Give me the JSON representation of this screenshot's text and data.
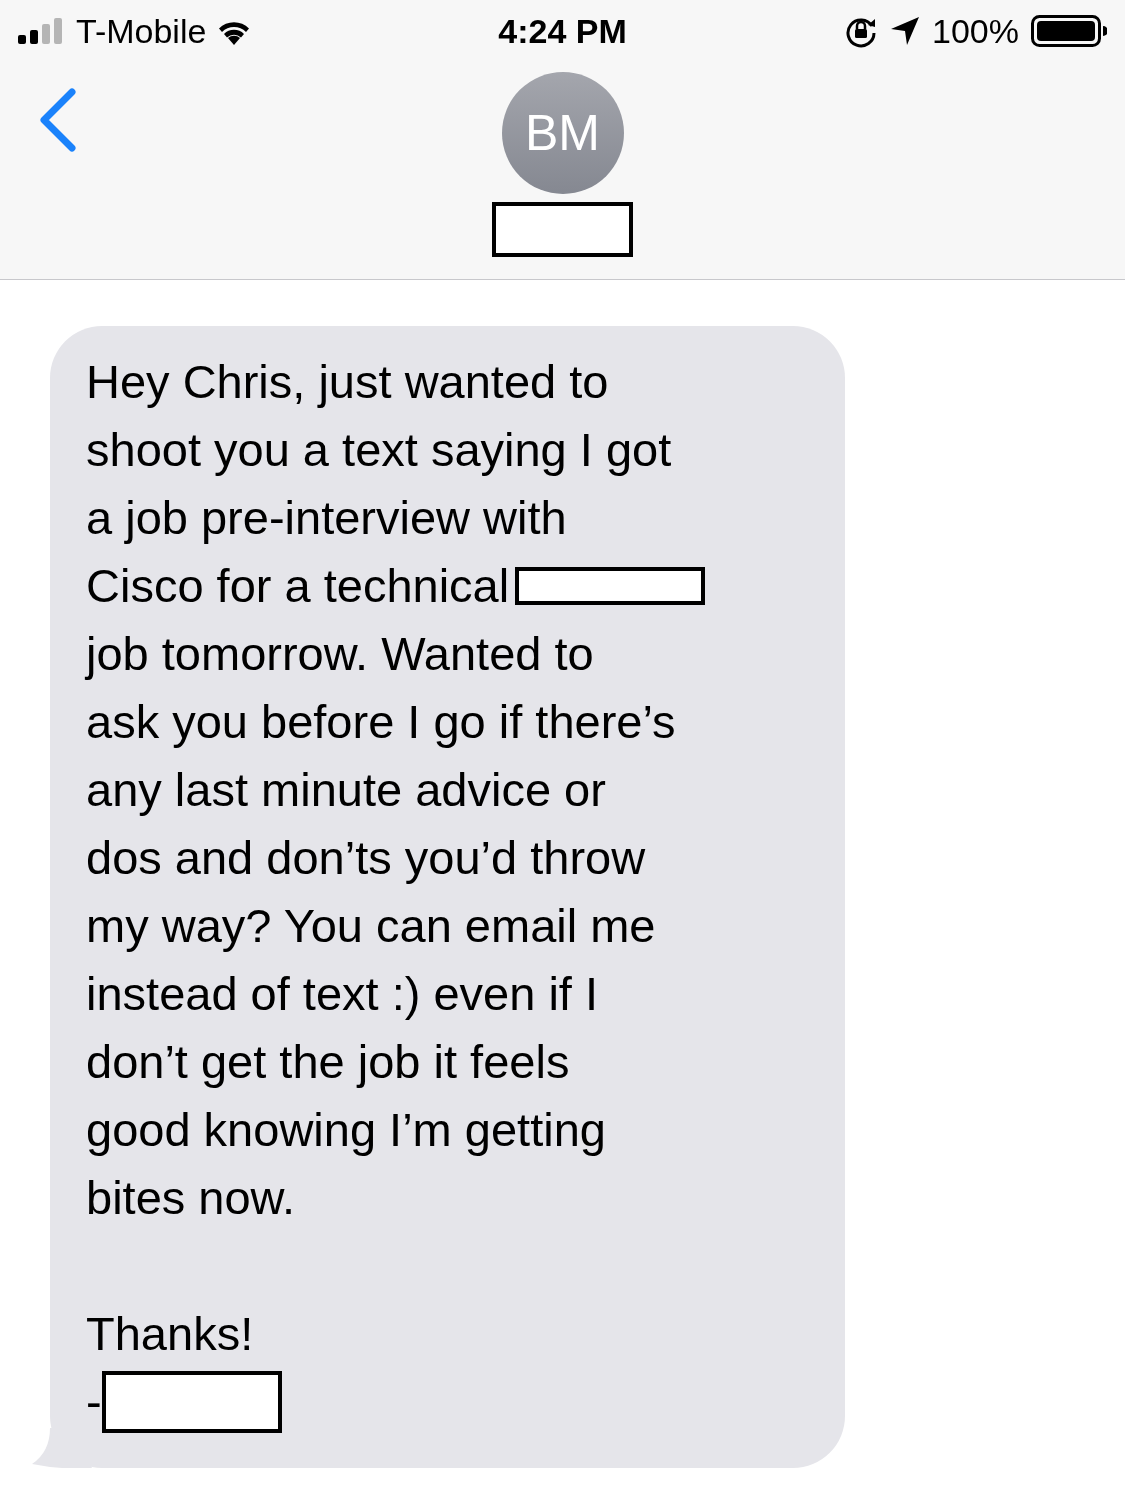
{
  "status_bar": {
    "carrier": "T-Mobile",
    "time": "4:24 PM",
    "battery": "100%"
  },
  "header": {
    "avatar_initials": "BM"
  },
  "message": {
    "lines": [
      {
        "text": "Hey Chris, just wanted to",
        "redaction": false
      },
      {
        "text": "shoot you a text saying I got",
        "redaction": false
      },
      {
        "text": "a job pre-interview with",
        "redaction": false
      },
      {
        "text": "Cisco for a technical",
        "redaction": true
      },
      {
        "text": "job tomorrow. Wanted to",
        "redaction": false
      },
      {
        "text": "ask you before I go if there’s",
        "redaction": false
      },
      {
        "text": "any last minute advice or",
        "redaction": false
      },
      {
        "text": "dos and don’ts you’d throw",
        "redaction": false
      },
      {
        "text": "my way? You can email me",
        "redaction": false
      },
      {
        "text": "instead of text :) even if I",
        "redaction": false
      },
      {
        "text": "don’t get the job it feels",
        "redaction": false
      },
      {
        "text": "good knowing I’m getting",
        "redaction": false
      },
      {
        "text": "bites now.",
        "redaction": false
      }
    ],
    "closing": "Thanks!",
    "signoff": "-"
  }
}
